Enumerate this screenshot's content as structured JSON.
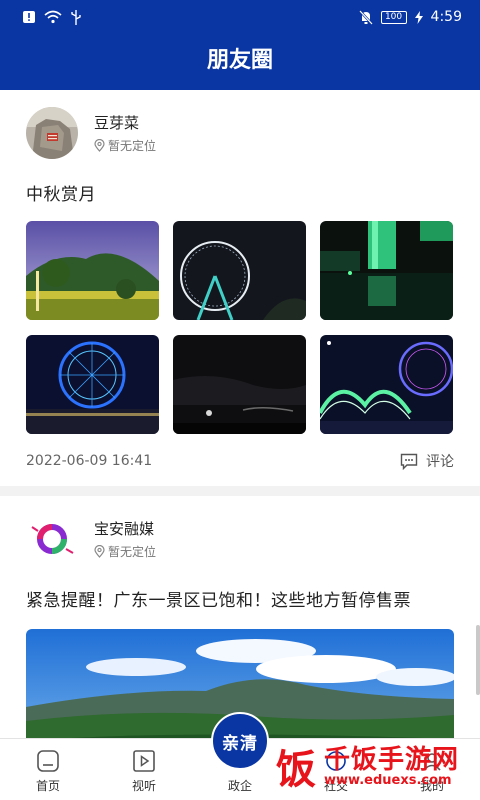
{
  "status_bar": {
    "battery": "100",
    "time": "4:59",
    "icons": [
      "alert-icon",
      "wifi-icon",
      "usb-icon",
      "mute-icon",
      "charging-icon"
    ]
  },
  "header": {
    "title": "朋友圈"
  },
  "posts": [
    {
      "author": "豆芽菜",
      "location": "暂无定位",
      "text": "中秋赏月",
      "images": [
        "park-lawn-night",
        "ferris-wheel-night",
        "green-lit-skyscraper",
        "ferris-wheel-blue-lights",
        "dark-sky-moon",
        "ferris-wheel-arch-bridge"
      ],
      "time": "2022-06-09 16:41",
      "comment_label": "评论"
    },
    {
      "author": "宝安融媒",
      "location": "暂无定位",
      "text": "紧急提醒！广东一景区已饱和！这些地方暂停售票",
      "images": [
        "mountain-landscape-banner"
      ]
    }
  ],
  "bottom_nav": [
    {
      "label": "首页",
      "icon": "home-icon"
    },
    {
      "label": "视听",
      "icon": "play-icon"
    },
    {
      "label": "政企",
      "icon": ""
    },
    {
      "label": "社交",
      "icon": "social-icon"
    },
    {
      "label": "我的",
      "icon": "profile-icon"
    }
  ],
  "center_badge": "亲清",
  "watermark": {
    "title": "千饭手游网",
    "url": "www.eduexs.com",
    "glyph": "饭"
  },
  "colors": {
    "brand_blue": "#0a36a4",
    "watermark_red": "#e8141b"
  }
}
